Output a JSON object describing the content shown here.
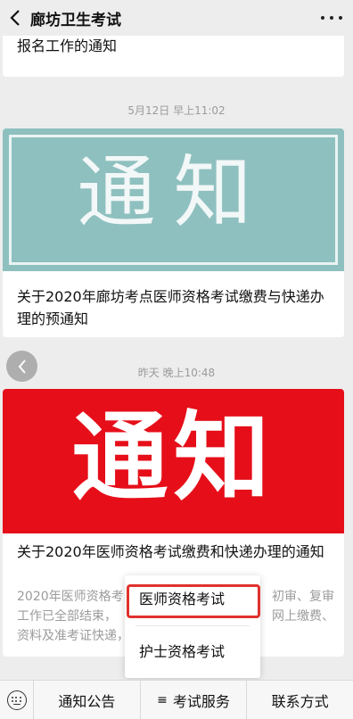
{
  "header": {
    "title": "廊坊卫生考试"
  },
  "messages": [
    {
      "title": "报名工作的通知"
    },
    {
      "time": "5月12日 早上11:02",
      "banner_text": "通知",
      "title": "关于2020年廊坊考点医师资格考试缴费与快递办理的预通知"
    },
    {
      "time": "昨天 晚上10:48",
      "banner_text": "通知",
      "title": "关于2020年医师资格考试缴费和快递办理的通知",
      "desc_lines": [
        "2020年医师资格考",
        "工作已全部结束，",
        "资料及准考证快递，"
      ],
      "desc_right_lines": [
        "初审、复审",
        "网上缴费、"
      ]
    }
  ],
  "popup_menu": {
    "items": [
      "医师资格考试",
      "护士资格考试"
    ],
    "highlighted_index": 0
  },
  "bottom_menu": {
    "tabs": [
      "通知公告",
      "考试服务",
      "联系方式"
    ],
    "menu_glyph": "≡"
  },
  "colors": {
    "teal_banner": "#8ec0bf",
    "red_banner": "#e60e19",
    "highlight_border": "#e0312e"
  },
  "icons": [
    "back-arrow-icon",
    "more-dots-icon",
    "circle-back-icon",
    "keyboard-icon"
  ]
}
